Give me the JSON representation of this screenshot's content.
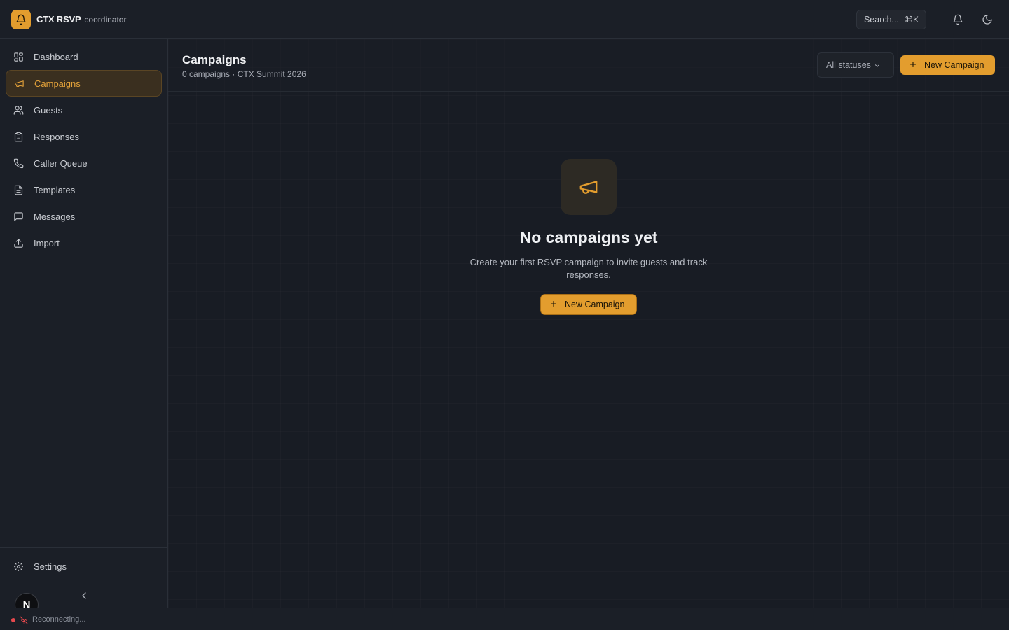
{
  "app": {
    "name": "CTX RSVP",
    "role": "coordinator",
    "accent": "#e39d2e"
  },
  "topbar": {
    "search_label": "Search...",
    "search_shortcut": "⌘K",
    "icons": [
      "bell-icon",
      "moon-icon"
    ]
  },
  "sidebar": {
    "items": [
      {
        "label": "Dashboard",
        "icon": "grid-icon"
      },
      {
        "label": "Campaigns",
        "icon": "megaphone-icon",
        "active": true
      },
      {
        "label": "Guests",
        "icon": "users-icon"
      },
      {
        "label": "Responses",
        "icon": "clipboard-icon"
      },
      {
        "label": "Caller Queue",
        "icon": "phone-icon"
      },
      {
        "label": "Templates",
        "icon": "file-icon"
      },
      {
        "label": "Messages",
        "icon": "message-icon"
      },
      {
        "label": "Import",
        "icon": "upload-icon"
      }
    ],
    "settings_label": "Settings",
    "avatar_initial": "N"
  },
  "header": {
    "title": "Campaigns",
    "subtitle": "0 campaigns · CTX Summit 2026",
    "filter_value": "All statuses",
    "new_button": "New Campaign"
  },
  "empty_state": {
    "title": "No campaigns yet",
    "description": "Create your first RSVP campaign to invite guests and track responses.",
    "button": "New Campaign"
  },
  "statusbar": {
    "text": "Reconnecting..."
  }
}
